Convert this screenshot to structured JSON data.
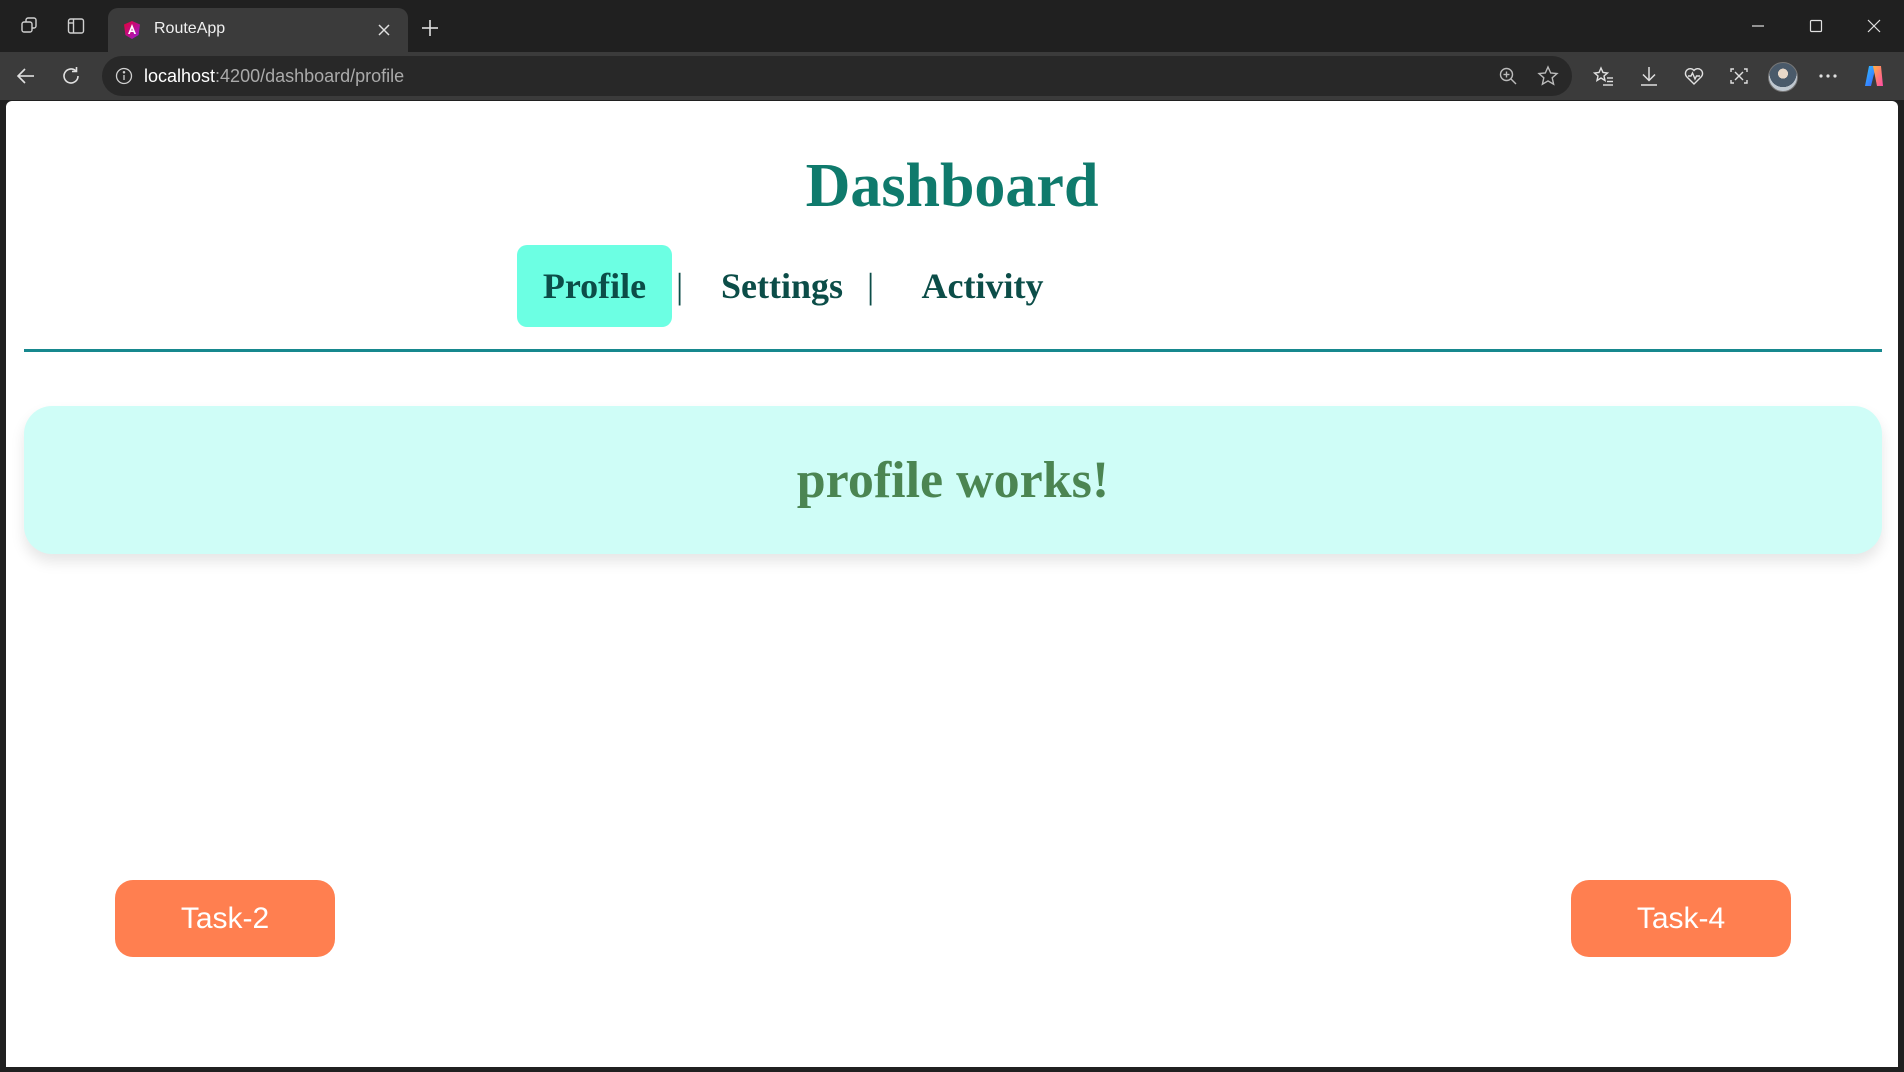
{
  "browser": {
    "tab_title": "RouteApp",
    "url_host": "localhost",
    "url_rest": ":4200/dashboard/profile",
    "icons": [
      "workspaces-icon",
      "vertical-tabs-icon",
      "close-tab-icon",
      "new-tab-icon",
      "minimize-icon",
      "maximize-icon",
      "window-close-icon",
      "back-icon",
      "refresh-icon",
      "site-info-icon",
      "zoom-icon",
      "favorite-star-icon",
      "favorites-icon",
      "downloads-icon",
      "browser-essentials-icon",
      "screenshot-icon",
      "profile-avatar",
      "more-icon",
      "copilot-icon"
    ]
  },
  "page": {
    "title": "Dashboard",
    "nav": {
      "items": [
        {
          "label": "Profile",
          "active": true
        },
        {
          "label": "Settings",
          "active": false
        },
        {
          "label": "Activity",
          "active": false
        }
      ],
      "separator": "|"
    },
    "content": {
      "message": "profile works!"
    },
    "buttons": {
      "prev_label": "Task-2",
      "next_label": "Task-4"
    }
  },
  "colors": {
    "title": "#0f7a6c",
    "active_tab_bg": "#6cffe3",
    "divider": "#17888e",
    "card_bg": "#cffdf7",
    "card_text": "#4b8552",
    "task_button_bg": "#ff7f50"
  }
}
